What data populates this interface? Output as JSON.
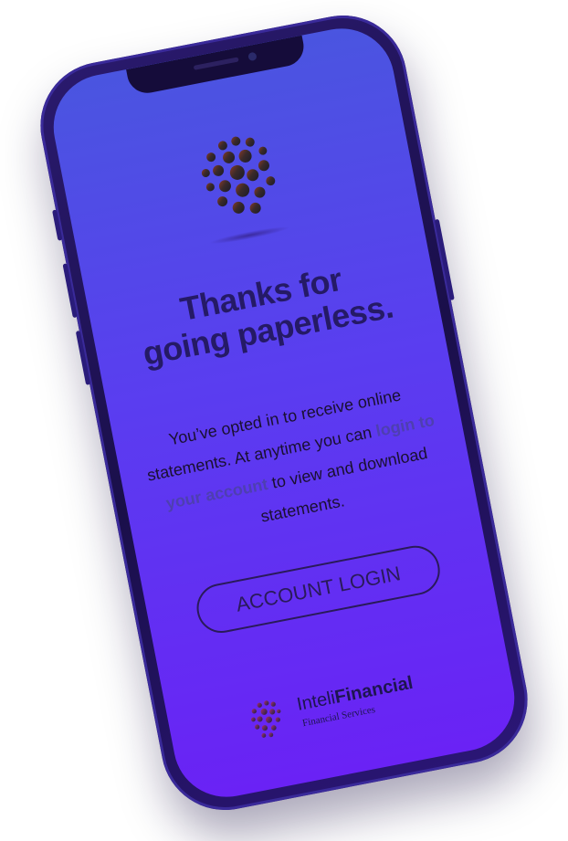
{
  "headline": {
    "line1": "Thanks for",
    "line2": "going paperless."
  },
  "body": {
    "text_start": "You’ve opted in to receive online statements. At anytime you can ",
    "link_text": "login to your account",
    "text_end": " to view and download statements."
  },
  "cta": {
    "label": "ACCOUNT LOGIN"
  },
  "brand": {
    "name_light": "Inteli",
    "name_bold": "Financial",
    "tagline": "Financial Services"
  },
  "colors": {
    "screen_top": "#4a55e0",
    "screen_bottom": "#6a22f5",
    "headline": "#251a66",
    "link": "#4e3fb0",
    "phone_frame": "#1a0f4a"
  },
  "icons": {
    "logo": "dotted-globe-icon"
  }
}
